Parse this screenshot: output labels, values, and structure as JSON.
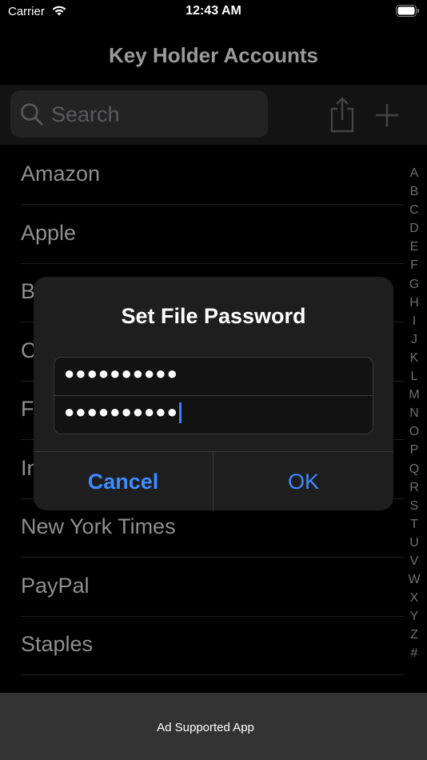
{
  "status_bar": {
    "carrier": "Carrier",
    "time": "12:43 AM"
  },
  "nav": {
    "title": "Key Holder Accounts"
  },
  "search": {
    "placeholder": "Search"
  },
  "accounts": [
    "Amazon",
    "Apple",
    "B",
    "C",
    "Fa",
    "In",
    "New York Times",
    "PayPal",
    "Staples"
  ],
  "index_letters": [
    "A",
    "B",
    "C",
    "D",
    "E",
    "F",
    "G",
    "H",
    "I",
    "J",
    "K",
    "L",
    "M",
    "N",
    "O",
    "P",
    "Q",
    "R",
    "S",
    "T",
    "U",
    "V",
    "W",
    "X",
    "Y",
    "Z",
    "#"
  ],
  "dialog": {
    "title": "Set File Password",
    "password_value": "●●●●●●●●●●",
    "confirm_value": "●●●●●●●●●●",
    "cancel_label": "Cancel",
    "ok_label": "OK"
  },
  "ad": {
    "text": "Ad Supported App"
  },
  "colors": {
    "accent": "#3d8bff",
    "background": "#000000",
    "dialog": "#1e1e1e"
  }
}
